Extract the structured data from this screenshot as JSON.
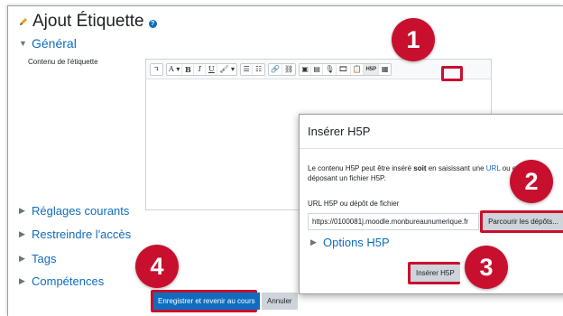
{
  "page": {
    "title": "Ajout Étiquette",
    "help_glyph": "?",
    "general_label": "Général",
    "content_label": "Contenu de l'étiquette"
  },
  "toolbar": {
    "items": [
      "↴",
      "A ▾",
      "B",
      "I",
      "U",
      "🖌 ▾",
      "☰",
      "☷",
      "🔗",
      "⛓",
      "▣",
      "▤",
      "🎙",
      "🎞",
      "📋",
      "H5P",
      "▦"
    ]
  },
  "sections": {
    "reglages": "Réglages courants",
    "restreindre": "Restreindre l'accès",
    "tags": "Tags",
    "competences": "Compétences"
  },
  "footer": {
    "save_label": "Enregistrer et revenir au cours",
    "cancel_label": "Annuler"
  },
  "modal": {
    "title": "Insérer H5P",
    "close": "×",
    "desc_part1": "Le contenu H5P peut être inséré ",
    "desc_bold": "soit",
    "desc_part2": " en saisissant une ",
    "desc_link": "URL",
    "desc_part3": " ou en déposant un fichier H5P.",
    "url_label": "URL H5P ou dépôt de fichier",
    "url_value": "https://0100081j.moodle.monbureaunumerique.fr",
    "browse_label": "Parcourir les dépôts...",
    "options_label": "Options H5P",
    "insert_label": "Insérer H5P"
  },
  "badges": [
    "1",
    "2",
    "3",
    "4"
  ],
  "colors": {
    "accent": "#0f6cbf",
    "highlight": "#c8102e"
  }
}
